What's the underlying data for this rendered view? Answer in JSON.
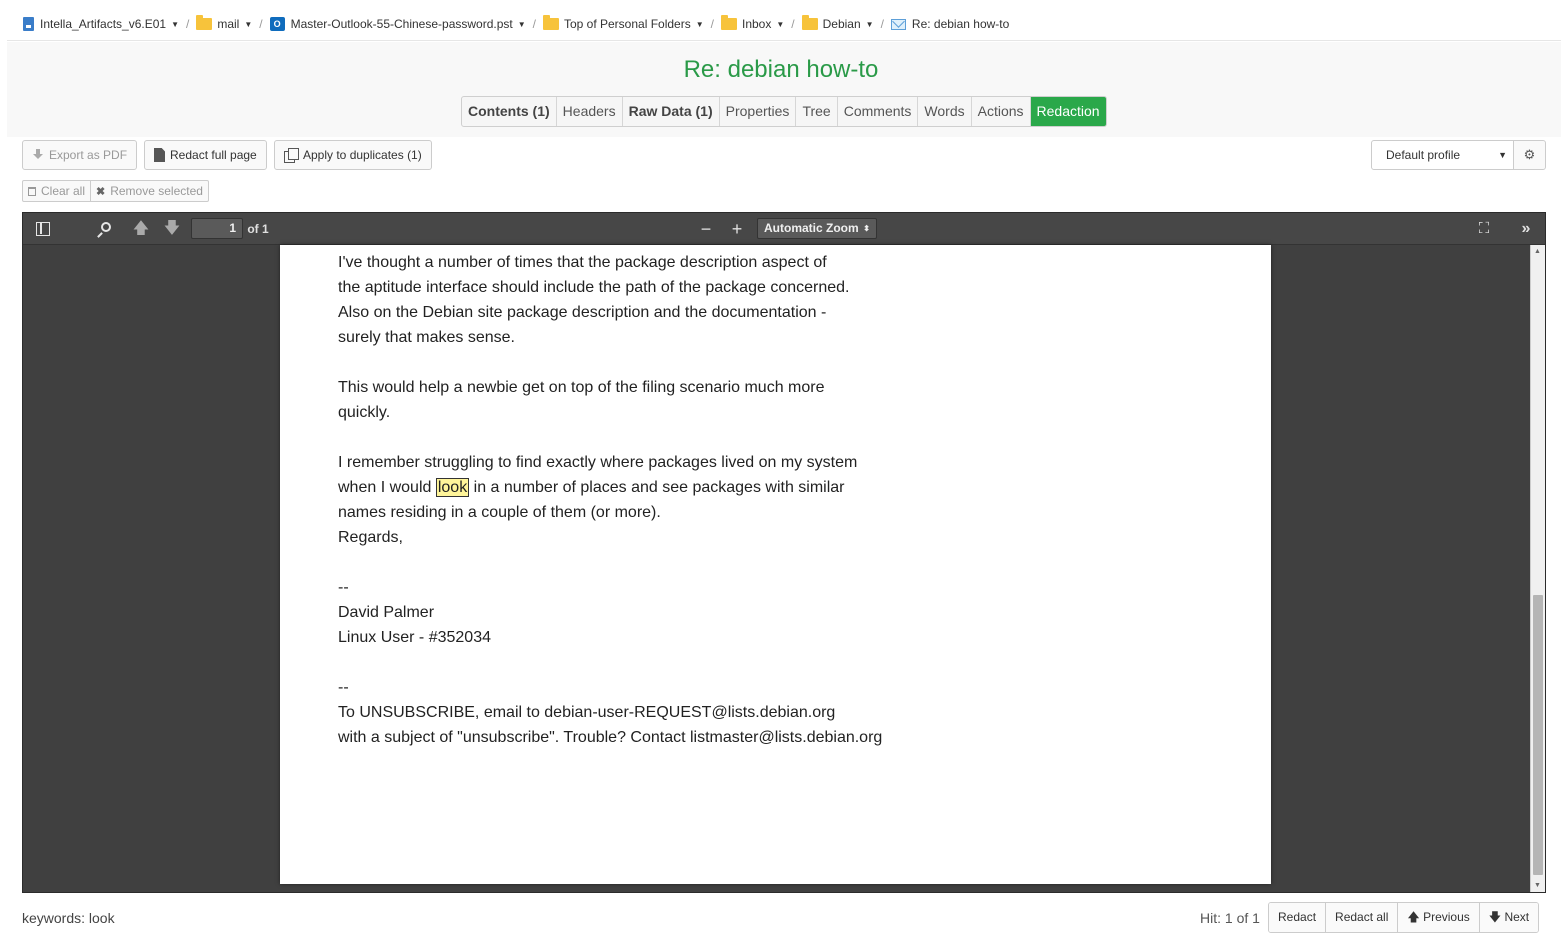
{
  "breadcrumb": [
    {
      "label": "Intella_Artifacts_v6.E01",
      "icon": "disk-image-icon"
    },
    {
      "label": "mail",
      "icon": "folder-icon"
    },
    {
      "label": "Master-Outlook-55-Chinese-password.pst",
      "icon": "outlook-icon"
    },
    {
      "label": "Top of Personal Folders",
      "icon": "folder-icon"
    },
    {
      "label": "Inbox",
      "icon": "folder-icon"
    },
    {
      "label": "Debian",
      "icon": "folder-icon"
    },
    {
      "label": "Re: debian how-to",
      "icon": "email-icon"
    }
  ],
  "breadcrumb_separator": "/",
  "title": "Re: debian how-to",
  "tabs": [
    {
      "label": "Contents (1)"
    },
    {
      "label": "Headers"
    },
    {
      "label": "Raw Data (1)"
    },
    {
      "label": "Properties"
    },
    {
      "label": "Tree"
    },
    {
      "label": "Comments"
    },
    {
      "label": "Words"
    },
    {
      "label": "Actions"
    },
    {
      "label": "Redaction"
    }
  ],
  "active_tab": "Redaction",
  "actions": {
    "export_pdf": "Export as PDF",
    "redact_full_page": "Redact full page",
    "apply_duplicates": "Apply to duplicates (1)",
    "clear_all": "Clear all",
    "remove_selected": "Remove selected"
  },
  "profile": {
    "selected": "Default profile"
  },
  "viewer": {
    "page_number": "1",
    "page_total": "of 1",
    "zoom": "Automatic Zoom",
    "zoom_out": "−",
    "zoom_in": "+"
  },
  "document": {
    "lines": [
      "I've thought a number of times that the package description aspect of",
      "the aptitude interface should include the path of the package concerned.",
      "Also on the Debian site package description and the documentation -",
      "surely that makes sense.",
      "",
      "This would help a newbie get on top of the filing scenario much more",
      "quickly.",
      "",
      "I remember struggling to find exactly where packages lived on my system",
      "",
      "names residing in a couple of them (or more).",
      "Regards,",
      "",
      "--",
      "David Palmer",
      "Linux User - #352034",
      "",
      "--",
      "To UNSUBSCRIBE, email to debian-user-REQUEST@lists.debian.org",
      "with a subject of \"unsubscribe\". Trouble? Contact listmaster@lists.debian.org"
    ],
    "hit_line_before": "when I would ",
    "hit_word": "look",
    "hit_line_after": " in a number of places and see packages with similar"
  },
  "footer": {
    "keywords": "keywords: look",
    "hit": "Hit: 1 of 1",
    "redact": "Redact",
    "redact_all": "Redact all",
    "previous": "Previous",
    "next": "Next"
  },
  "colors": {
    "accent": "#2aa84a",
    "title": "#2a9a48",
    "highlight": "#fff59a",
    "viewer_bg": "#404040"
  }
}
